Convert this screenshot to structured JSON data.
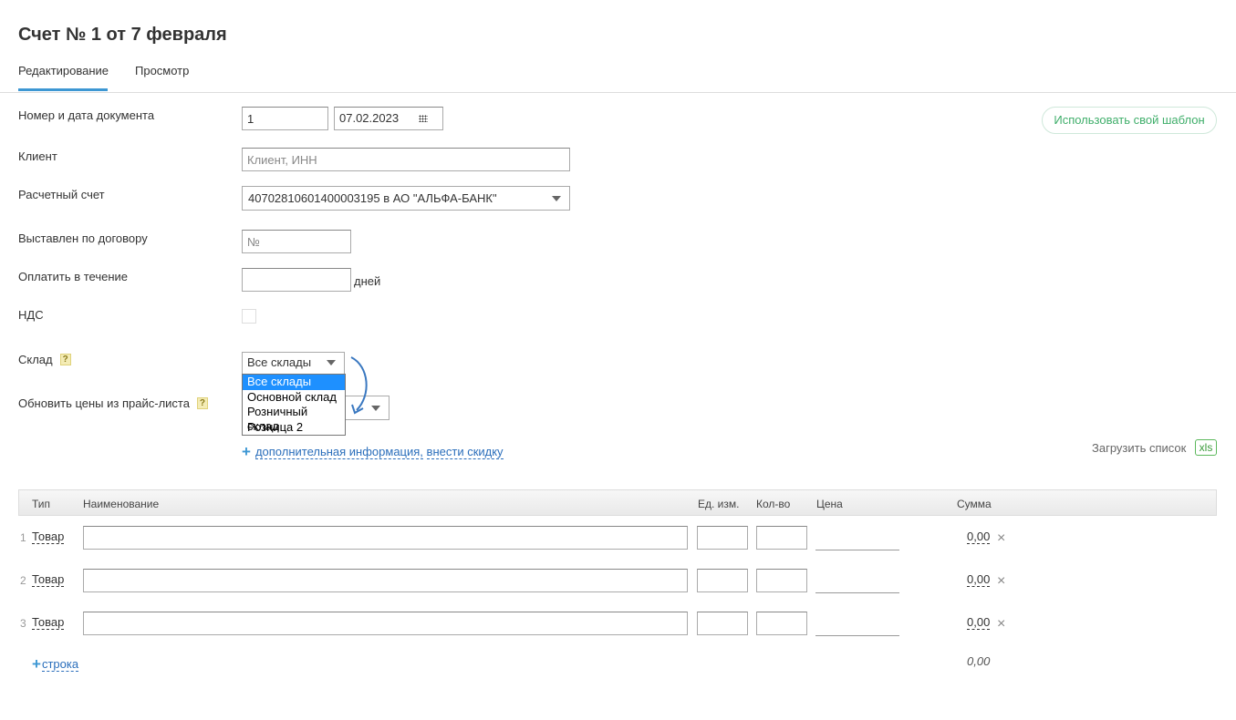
{
  "page": {
    "title": "Счет № 1 от 7 февраля"
  },
  "tabs": [
    {
      "label": "Редактирование"
    },
    {
      "label": "Просмотр"
    }
  ],
  "form": {
    "doc_label": "Номер и дата документа",
    "doc_number": "1",
    "doc_date": "07.02.2023",
    "client_label": "Клиент",
    "client_placeholder": "Клиент, ИНН",
    "account_label": "Расчетный счет",
    "account_value": "40702810601400003195 в АО \"АЛЬФА-БАНК\"",
    "contract_label": "Выставлен по договору",
    "contract_placeholder": "№",
    "pay_label": "Оплатить в течение",
    "pay_value": "",
    "pay_unit": "дней",
    "vat_label": "НДС",
    "warehouse_label": "Склад",
    "warehouse_value": "Все склады",
    "warehouse_options": [
      "Все склады",
      "Основной склад",
      "Розничный склад",
      "Розница 2"
    ],
    "pricelist_label": "Обновить цены из прайс-листа",
    "help_glyph": "?",
    "extra_info_link": "дополнительная информация,",
    "discount_link": "внести скидку"
  },
  "template_button": "Использовать свой шаблон",
  "upload": {
    "label": "Загрузить список",
    "xls": "xls"
  },
  "table": {
    "headers": {
      "type": "Тип",
      "name": "Наименование",
      "unit": "Ед. изм.",
      "qty": "Кол-во",
      "price": "Цена",
      "sum": "Сумма"
    },
    "rows": [
      {
        "num": "1",
        "type": "Товар",
        "sum": "0,00"
      },
      {
        "num": "2",
        "type": "Товар",
        "sum": "0,00"
      },
      {
        "num": "3",
        "type": "Товар",
        "sum": "0,00"
      }
    ],
    "add_row": "строка",
    "total": "0,00"
  },
  "icons": {
    "delete": "×",
    "plus": "+"
  },
  "colors": {
    "accent": "#3d97d3",
    "green": "#3fae6a",
    "selection": "#1e90ff"
  }
}
